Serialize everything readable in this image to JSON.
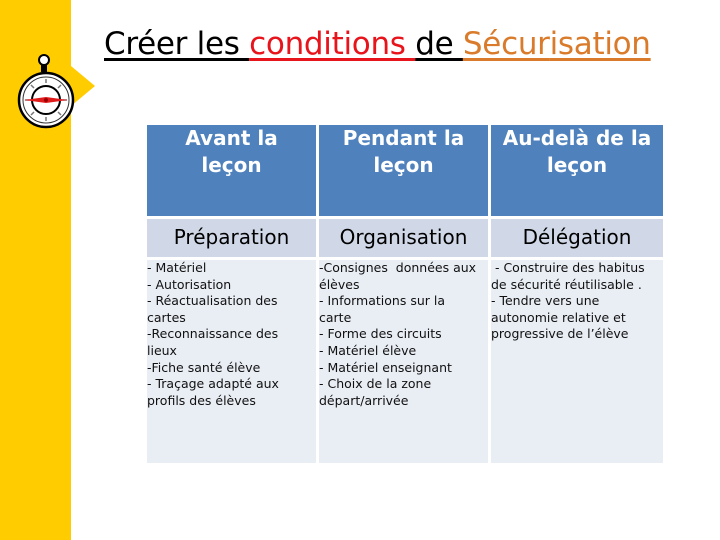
{
  "title": {
    "parts": [
      {
        "text": "Créer les ",
        "color": "#000000"
      },
      {
        "text": "conditions ",
        "color": "#e8141c"
      },
      {
        "text": "de ",
        "color": "#000000"
      },
      {
        "text": "Sécur",
        "color": "#d97b2b"
      },
      {
        "text": "isation",
        "color": "#d97b2b"
      }
    ]
  },
  "colors": {
    "sidebar": "#ffcc00",
    "header_bg": "#4f81bd",
    "subheader_bg": "#d0d8e8",
    "body_bg": "#e9edf4"
  },
  "decoration": {
    "icon": "compass-icon"
  },
  "table": {
    "columns": [
      {
        "header_line1": "Avant la",
        "header_line2": "leçon",
        "phase": "Préparation",
        "items": [
          "- Matériel",
          "- Autorisation",
          "- Réactualisation des",
          "cartes",
          "-Reconnaissance des",
          "lieux",
          "-Fiche santé élève",
          "- Traçage adapté aux",
          "profils des élèves"
        ]
      },
      {
        "header_line1": "Pendant la",
        "header_line2": "leçon",
        "phase": "Organisation",
        "items": [
          "-Consignes  données aux",
          "élèves",
          "- Informations sur la",
          "carte",
          "- Forme des circuits",
          "- Matériel élève",
          "- Matériel enseignant",
          "- Choix de la zone",
          "départ/arrivée"
        ]
      },
      {
        "header_line1": "Au-delà de la",
        "header_line2": "leçon",
        "phase": "Délégation",
        "items": [
          " - Construire des habitus",
          "de sécurité réutilisable .",
          "- Tendre vers une",
          "autonomie relative et",
          "progressive de l’élève"
        ]
      }
    ]
  }
}
